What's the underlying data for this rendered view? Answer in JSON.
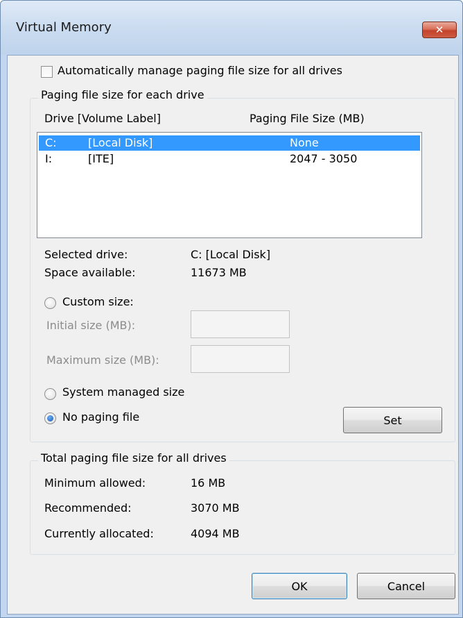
{
  "window": {
    "title": "Virtual Memory",
    "close_symbol": "✕"
  },
  "auto_manage": {
    "label": "Automatically manage paging file size for all drives",
    "checked": false
  },
  "paging_group": {
    "title": "Paging file size for each drive",
    "headers": {
      "drive": "Drive  [Volume Label]",
      "size": "Paging File Size (MB)"
    },
    "drives": [
      {
        "letter": "C:",
        "label": "[Local Disk]",
        "size": "None",
        "selected": true
      },
      {
        "letter": "I:",
        "label": "[ITE]",
        "size": "2047 - 3050",
        "selected": false
      }
    ],
    "selected_drive_label": "Selected drive:",
    "selected_drive_value": "C:  [Local Disk]",
    "space_available_label": "Space available:",
    "space_available_value": "11673 MB",
    "custom_size_label": "Custom size:",
    "initial_size_label": "Initial size (MB):",
    "initial_size_value": "",
    "maximum_size_label": "Maximum size (MB):",
    "maximum_size_value": "",
    "system_managed_label": "System managed size",
    "no_paging_label": "No paging file",
    "paging_option": "no_paging",
    "set_button": "Set"
  },
  "total_group": {
    "title": "Total paging file size for all drives",
    "minimum_label": "Minimum allowed:",
    "minimum_value": "16 MB",
    "recommended_label": "Recommended:",
    "recommended_value": "3070 MB",
    "allocated_label": "Currently allocated:",
    "allocated_value": "4094 MB"
  },
  "buttons": {
    "ok": "OK",
    "cancel": "Cancel"
  }
}
